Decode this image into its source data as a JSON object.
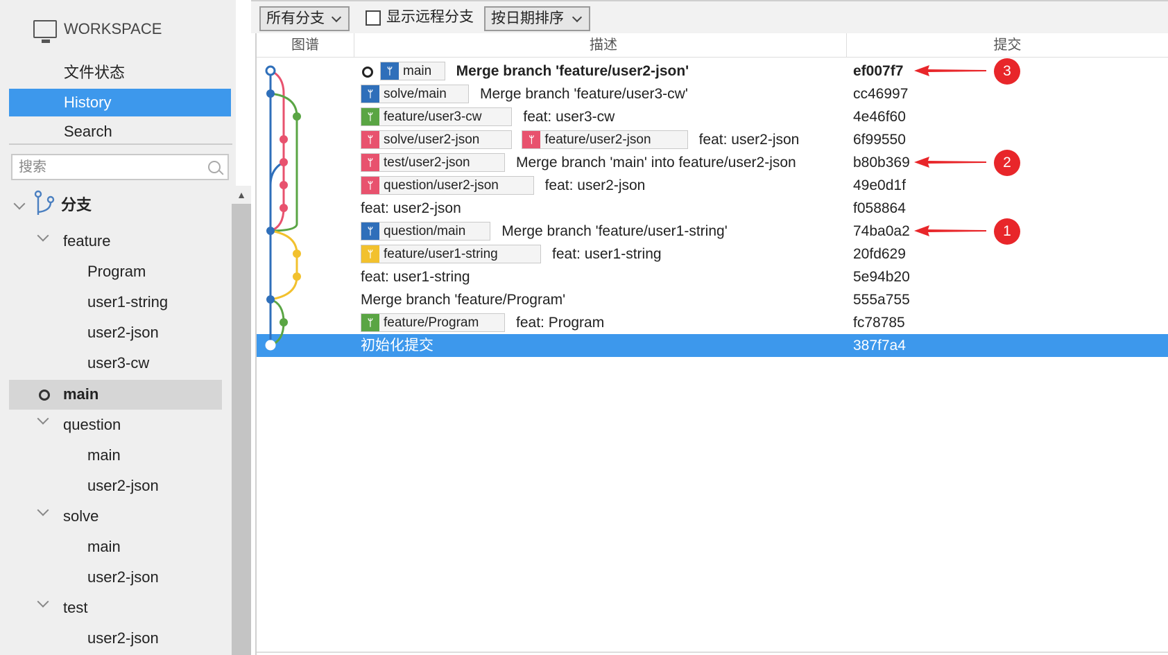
{
  "sidebar": {
    "workspace_label": "WORKSPACE",
    "nav": [
      "文件状态",
      "History",
      "Search"
    ],
    "active_nav": "History",
    "search_placeholder": "搜索",
    "branches_heading": "分支",
    "groups": [
      {
        "name": "feature",
        "children": [
          "Program",
          "user1-string",
          "user2-json",
          "user3-cw"
        ]
      },
      {
        "name": "main",
        "current": true
      },
      {
        "name": "question",
        "children": [
          "main",
          "user2-json"
        ]
      },
      {
        "name": "solve",
        "children": [
          "main",
          "user2-json"
        ]
      },
      {
        "name": "test",
        "children": [
          "user2-json"
        ]
      }
    ]
  },
  "toolbar": {
    "branch_filter": "所有分支",
    "show_remote_label": "显示远程分支",
    "show_remote_checked": false,
    "sort": "按日期排序"
  },
  "columns": {
    "graph": "图谱",
    "desc": "描述",
    "commit": "提交"
  },
  "commits": [
    {
      "head": true,
      "tags": [
        {
          "name": "main",
          "color": "#2f6fba"
        }
      ],
      "desc": "Merge branch 'feature/user2-json'",
      "hash": "ef007f7",
      "bold": true
    },
    {
      "tags": [
        {
          "name": "solve/main",
          "color": "#2f6fba"
        }
      ],
      "desc": "Merge branch 'feature/user3-cw'",
      "hash": "cc46997"
    },
    {
      "tags": [
        {
          "name": "feature/user3-cw",
          "color": "#5aa544"
        }
      ],
      "desc": "feat: user3-cw",
      "hash": "4e46f60"
    },
    {
      "tags": [
        {
          "name": "solve/user2-json",
          "color": "#e8526e"
        },
        {
          "name": "feature/user2-json",
          "color": "#e8526e"
        }
      ],
      "desc": "feat: user2-json",
      "hash": "6f99550"
    },
    {
      "tags": [
        {
          "name": "test/user2-json",
          "color": "#e8526e"
        }
      ],
      "desc": "Merge branch 'main' into feature/user2-json",
      "hash": "b80b369"
    },
    {
      "tags": [
        {
          "name": "question/user2-json",
          "color": "#e8526e"
        }
      ],
      "desc": "feat: user2-json",
      "hash": "49e0d1f"
    },
    {
      "tags": [],
      "desc": "feat: user2-json",
      "hash": "f058864"
    },
    {
      "tags": [
        {
          "name": "question/main",
          "color": "#2f6fba"
        }
      ],
      "desc": "Merge branch 'feature/user1-string'",
      "hash": "74ba0a2"
    },
    {
      "tags": [
        {
          "name": "feature/user1-string",
          "color": "#f2c12e"
        }
      ],
      "desc": "feat: user1-string",
      "hash": "20fd629"
    },
    {
      "tags": [],
      "desc": "feat: user1-string",
      "hash": "5e94b20"
    },
    {
      "tags": [],
      "desc": "Merge branch 'feature/Program'",
      "hash": "555a755"
    },
    {
      "tags": [
        {
          "name": "feature/Program",
          "color": "#5aa544"
        }
      ],
      "desc": "feat: Program",
      "hash": "fc78785"
    },
    {
      "tags": [],
      "desc": "初始化提交",
      "hash": "387f7a4",
      "selected": true
    }
  ],
  "annotations": [
    {
      "label": "3",
      "hash": "ef007f7"
    },
    {
      "label": "2",
      "hash": "b80b369"
    },
    {
      "label": "1",
      "hash": "74ba0a2"
    }
  ],
  "colors": {
    "accent": "#3d98ec",
    "blue": "#2f6fba",
    "red": "#e8526e",
    "green": "#5aa544",
    "yellow": "#f2c12e",
    "marker": "#e8262a"
  },
  "icons": {
    "workspace": "monitor-icon",
    "branch": "branch-icon",
    "search": "search-icon"
  }
}
